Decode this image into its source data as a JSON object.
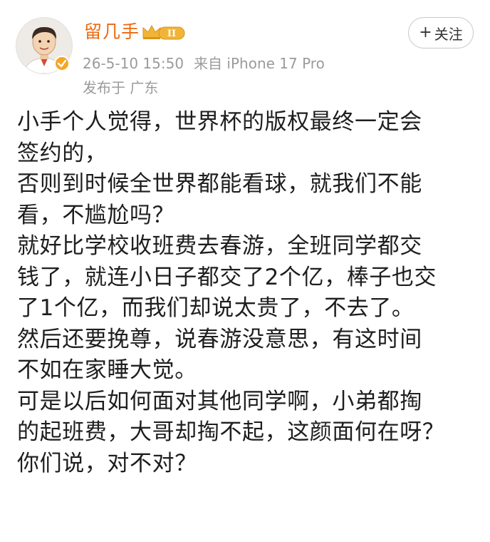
{
  "author": {
    "name": "留几手",
    "level_badge_text": "II",
    "avatar_icon": "cartoon-man-avatar",
    "verified_icon": "vip-verified-icon"
  },
  "meta": {
    "datetime": "26-5-10 15:50",
    "source": "来自 iPhone 17 Pro",
    "location": "发布于 广东"
  },
  "follow_button": {
    "label": "关注",
    "icon": "plus-icon"
  },
  "post": {
    "lines": [
      "小手个人觉得，世界杯的版权最终一定会",
      "签约的，",
      "否则到时候全世界都能看球，就我们不能",
      "看，不尴尬吗？",
      "就好比学校收班费去春游，全班同学都交",
      "钱了，就连小日子都交了2个亿，棒子也交",
      "了1个亿，而我们却说太贵了，不去了。",
      "然后还要挽尊，说春游没意思，有这时间",
      "不如在家睡大觉。",
      "可是以后如何面对其他同学啊，小弟都掏",
      "的起班费，大哥却掏不起，这颜面何在呀？",
      "你们说，对不对？"
    ]
  },
  "colors": {
    "username": "#eb6a12",
    "meta_text": "#9b9b9b",
    "badge_gold": "#f2b436"
  }
}
